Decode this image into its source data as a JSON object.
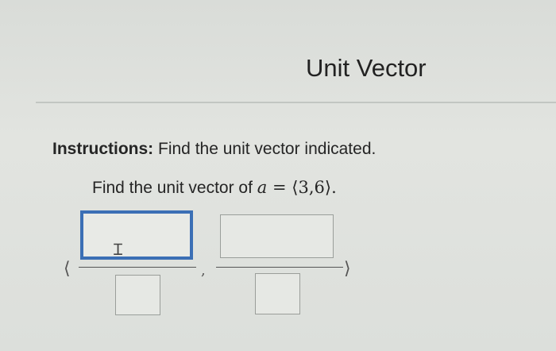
{
  "header": {
    "title": "Unit Vector"
  },
  "instructions": {
    "label": "Instructions:",
    "text": " Find the unit vector indicated."
  },
  "question": {
    "prefix": "Find the unit vector of ",
    "variable": "a",
    "equals": " = ",
    "vector": "⟨3,6⟩",
    "suffix": "."
  },
  "answer": {
    "open_bracket": "⟨",
    "close_bracket": "⟩",
    "separator": ",",
    "inputs": [
      {
        "position": "numerator-1",
        "value": ""
      },
      {
        "position": "denominator-1",
        "value": ""
      },
      {
        "position": "numerator-2",
        "value": ""
      },
      {
        "position": "denominator-2",
        "value": ""
      }
    ],
    "cursor_icon": "text-cursor-icon"
  }
}
